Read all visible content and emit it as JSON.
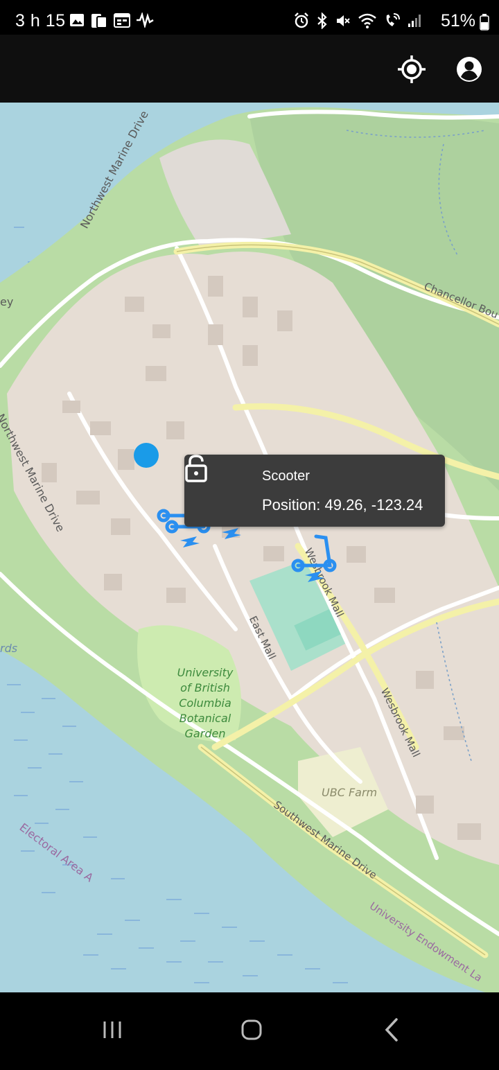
{
  "status_bar": {
    "time": "3 h 15",
    "battery": "51%",
    "left_icons": [
      "image-icon",
      "sim-card-icon",
      "calendar-icon",
      "activity-icon"
    ],
    "right_icons": [
      "alarm-icon",
      "bluetooth-icon",
      "mute-icon",
      "wifi-icon",
      "wifi-call-icon",
      "signal-icon",
      "battery-icon"
    ]
  },
  "app_bar": {
    "actions": [
      "my-location-icon",
      "account-circle-icon"
    ]
  },
  "map": {
    "labels": {
      "northwest_marine_drive_top": "Northwest Marine Drive",
      "northwest_marine_drive_left": "Northwest Marine Drive",
      "chancellor_boulevard": "Chancellor Bou",
      "east_mall": "East Mall",
      "wesbrook_mall_1": "Wesbrook Mall",
      "wesbrook_mall_2": "Wesbrook Mall",
      "botanical_garden": "University of British Columbia Botanical Garden",
      "ubc_farm": "UBC Farm",
      "southwest_marine_drive": "Southwest Marine Drive",
      "electoral_area": "Electoral Area A",
      "university_endowment": "University Endowment La",
      "left_edge_ey": "ey",
      "left_edge_rds": "rds"
    },
    "colors": {
      "water": "#a9d3df",
      "park": "#c8e6b2",
      "urban": "#e8e0d8",
      "user_location": "#1a9be8",
      "scooter": "#2a8ff0"
    }
  },
  "tooltip": {
    "icon": "lock-open-icon",
    "title": "Scooter",
    "position": "Position: 49.26, -123.24"
  },
  "nav_bar": {
    "buttons": [
      "recents-icon",
      "home-icon",
      "back-icon"
    ]
  }
}
